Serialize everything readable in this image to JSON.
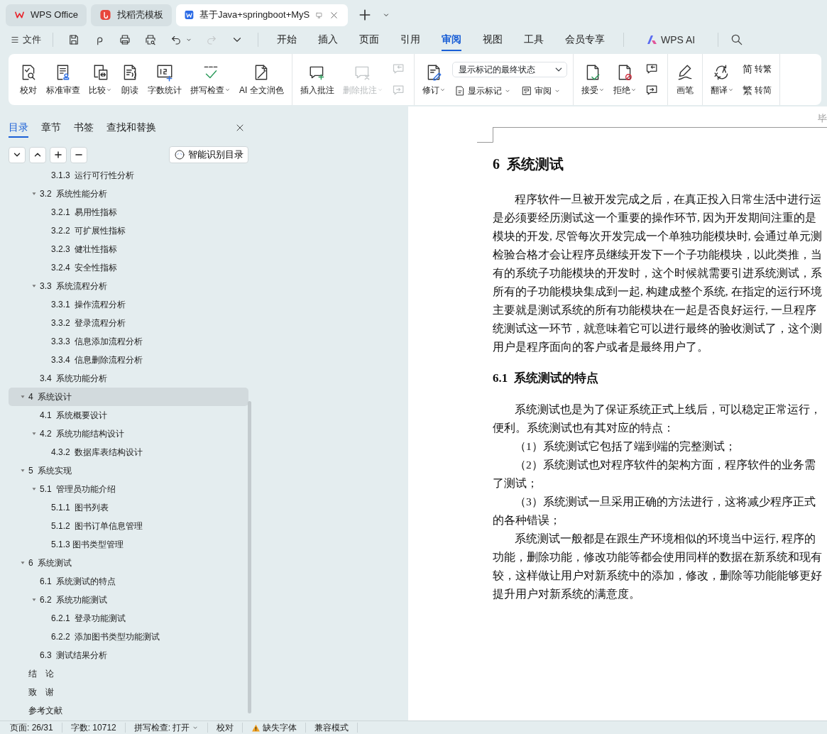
{
  "browser_tabs": [
    {
      "label": "WPS Office",
      "selected": false
    },
    {
      "label": "找稻壳模板",
      "selected": false
    },
    {
      "label": "基于Java+springboot+MyS",
      "selected": true
    }
  ],
  "menu": {
    "file_label": "文件",
    "quick_access": [
      {
        "disabled": false
      },
      {
        "disabled": false
      },
      {
        "disabled": false
      },
      {
        "disabled": false
      },
      {
        "disabled": false,
        "dropdown": true
      },
      {
        "disabled": true
      },
      {
        "disabled": false
      }
    ],
    "tabs": [
      {
        "label": "开始",
        "selected": false
      },
      {
        "label": "插入",
        "selected": false
      },
      {
        "label": "页面",
        "selected": false
      },
      {
        "label": "引用",
        "selected": false
      },
      {
        "label": "审阅",
        "selected": true
      },
      {
        "label": "视图",
        "selected": false
      },
      {
        "label": "工具",
        "selected": false
      },
      {
        "label": "会员专享",
        "selected": false
      }
    ],
    "ai_label": "WPS AI"
  },
  "ribbon": {
    "groups": [
      {
        "items": [
          {
            "kind": "large",
            "label": "校对"
          },
          {
            "kind": "large",
            "label": "标准审查"
          },
          {
            "kind": "large",
            "label": "比较",
            "dropdown": true
          },
          {
            "kind": "large",
            "label": "朗读"
          },
          {
            "kind": "large",
            "label": "字数统计"
          },
          {
            "kind": "large",
            "label": "拼写检查",
            "dropdown": true
          },
          {
            "kind": "large",
            "label": "AI 全文润色"
          }
        ]
      },
      {
        "items": [
          {
            "kind": "large",
            "label": "插入批注"
          },
          {
            "kind": "large",
            "label": "删除批注",
            "dropdown": true,
            "disabled": true
          },
          {
            "kind": "icon-pair",
            "disabled": true
          }
        ]
      },
      {
        "items": [
          {
            "kind": "large",
            "label": "修订",
            "dropdown": true
          },
          {
            "kind": "select-block",
            "value": "显示标记的最终状态",
            "buttons": [
              {
                "label": "显示标记",
                "dropdown": true
              },
              {
                "label": "审阅",
                "dropdown": true
              }
            ]
          }
        ]
      },
      {
        "items": [
          {
            "kind": "large",
            "label": "接受",
            "dropdown": true
          },
          {
            "kind": "large",
            "label": "拒绝",
            "dropdown": true
          },
          {
            "kind": "icon-pair",
            "disabled": false
          }
        ]
      },
      {
        "items": [
          {
            "kind": "large",
            "label": "画笔"
          }
        ]
      },
      {
        "items": [
          {
            "kind": "large",
            "label": "翻译",
            "dropdown": true
          },
          {
            "kind": "small-pair",
            "buttons": [
              {
                "glyph": "简",
                "label": "转繁"
              },
              {
                "glyph": "繁",
                "label": "转简"
              }
            ]
          }
        ]
      }
    ]
  },
  "sidebar": {
    "tabs": [
      {
        "label": "目录",
        "selected": true
      },
      {
        "label": "章节",
        "selected": false
      },
      {
        "label": "书签",
        "selected": false
      },
      {
        "label": "查找和替换",
        "selected": false
      }
    ],
    "smart_button": "智能识别目录",
    "toc": [
      {
        "children": [
          {
            "children": [
              {
                "label": "3.1.3  运行可行性分析",
                "selected": false
              }
            ]
          },
          {
            "label": "3.2  系统性能分析",
            "selected": false,
            "expanded": true,
            "children": [
              {
                "label": "3.2.1  易用性指标",
                "selected": false
              },
              {
                "label": "3.2.2  可扩展性指标",
                "selected": false
              },
              {
                "label": "3.2.3  健壮性指标",
                "selected": false
              },
              {
                "label": "3.2.4  安全性指标",
                "selected": false
              }
            ]
          },
          {
            "label": "3.3  系统流程分析",
            "selected": false,
            "expanded": true,
            "children": [
              {
                "label": "3.3.1  操作流程分析",
                "selected": false
              },
              {
                "label": "3.3.2  登录流程分析",
                "selected": false
              },
              {
                "label": "3.3.3  信息添加流程分析",
                "selected": false
              },
              {
                "label": "3.3.4  信息删除流程分析",
                "selected": false
              }
            ]
          },
          {
            "label": "3.4  系统功能分析",
            "selected": false
          }
        ]
      },
      {
        "label": "4  系统设计",
        "selected": true,
        "expanded": true,
        "children": [
          {
            "label": "4.1  系统概要设计",
            "selected": false
          },
          {
            "label": "4.2  系统功能结构设计",
            "selected": false,
            "expanded": true,
            "children": [
              {
                "label": "4.3.2  数据库表结构设计",
                "selected": false
              }
            ]
          }
        ]
      },
      {
        "label": "5  系统实现",
        "selected": false,
        "expanded": true,
        "children": [
          {
            "label": "5.1  管理员功能介绍",
            "selected": false,
            "expanded": true,
            "children": [
              {
                "label": "5.1.1  图书列表",
                "selected": false
              },
              {
                "label": "5.1.2  图书订单信息管理",
                "selected": false
              },
              {
                "label": "5.1.3 图书类型管理",
                "selected": false
              }
            ]
          }
        ]
      },
      {
        "label": "6  系统测试",
        "selected": false,
        "expanded": true,
        "children": [
          {
            "label": "6.1  系统测试的特点",
            "selected": false
          },
          {
            "label": "6.2  系统功能测试",
            "selected": false,
            "expanded": true,
            "children": [
              {
                "label": "6.2.1  登录功能测试",
                "selected": false
              },
              {
                "label": "6.2.2  添加图书类型功能测试",
                "selected": false
              }
            ]
          },
          {
            "label": "6.3  测试结果分析",
            "selected": false
          }
        ]
      },
      {
        "label": "结　论",
        "selected": false
      },
      {
        "label": "致　谢",
        "selected": false
      },
      {
        "label": "参考文献",
        "selected": false
      }
    ]
  },
  "document": {
    "header": "毕",
    "blocks": [
      {
        "kind": "heading1",
        "text": "6  系统测试"
      },
      {
        "kind": "paragraph",
        "lines": [
          "程序软件一旦被开发完成之后，在真正投入日常生活中进行运",
          "是必须要经历测试这一个重要的操作环节, 因为开发期间注重的是",
          "模块的开发, 尽管每次开发完成一个单独功能模块时, 会通过单元测",
          "检验合格才会让程序员继续开发下一个子功能模块，以此类推，当",
          "有的系统子功能模块的开发时，这个时候就需要引进系统测试，系",
          "所有的子功能模块集成到一起, 构建成整个系统, 在指定的运行环境",
          "主要就是测试系统的所有功能模块在一起是否良好运行, 一旦程序",
          "统测试这一环节，就意味着它可以进行最终的验收测试了，这个测",
          "用户是程序面向的客户或者是最终用户了。"
        ]
      },
      {
        "kind": "heading2",
        "text": "6.1  系统测试的特点"
      },
      {
        "kind": "paragraph",
        "lines": [
          "系统测试也是为了保证系统正式上线后，可以稳定正常运行，",
          "便利。系统测试也有其对应的特点："
        ]
      },
      {
        "kind": "paragraph",
        "lines": [
          "（1）系统测试它包括了端到端的完整测试；"
        ]
      },
      {
        "kind": "paragraph",
        "lines": [
          "（2）系统测试也对程序软件的架构方面，程序软件的业务需",
          "了测试；"
        ]
      },
      {
        "kind": "paragraph",
        "lines": [
          "（3）系统测试一旦采用正确的方法进行，这将减少程序正式",
          "的各种错误；"
        ]
      },
      {
        "kind": "paragraph",
        "lines": [
          "系统测试一般都是在跟生产环境相似的环境当中运行, 程序的",
          "功能，删除功能，修改功能等都会使用同样的数据在新系统和现有",
          "较，这样做让用户对新系统中的添加，修改，删除等功能能够更好",
          "提升用户对新系统的满意度。"
        ]
      }
    ]
  },
  "status_bar": {
    "items": [
      {
        "text": "页面: 26/31"
      },
      {
        "text": "字数: 10712"
      },
      {
        "text": "拼写检查: 打开",
        "dropdown": true
      },
      {
        "text": "校对"
      },
      {
        "text": "缺失字体",
        "warning": true
      },
      {
        "text": "兼容模式"
      }
    ]
  }
}
